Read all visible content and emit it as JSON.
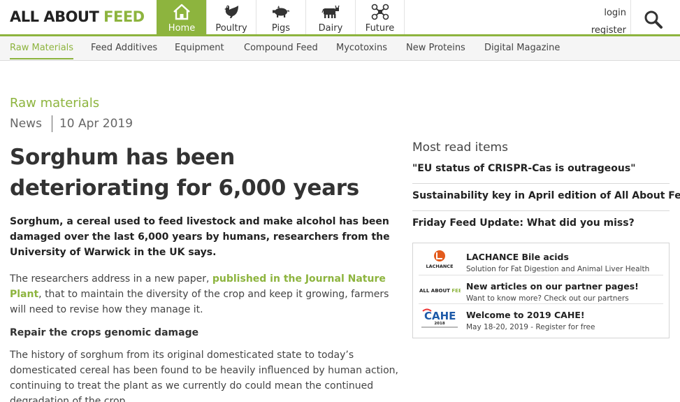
{
  "brand": {
    "name_part1": "ALL ABOUT ",
    "name_part2": "FEED"
  },
  "categories": [
    {
      "label": "Home",
      "icon": "home-icon",
      "active": true
    },
    {
      "label": "Poultry",
      "icon": "chicken-icon"
    },
    {
      "label": "Pigs",
      "icon": "pig-icon"
    },
    {
      "label": "Dairy",
      "icon": "cow-icon"
    },
    {
      "label": "Future",
      "icon": "drone-icon"
    }
  ],
  "auth": {
    "login": "login",
    "register": "register"
  },
  "subnav": [
    {
      "label": "Raw Materials",
      "active": true
    },
    {
      "label": "Feed Additives"
    },
    {
      "label": "Equipment"
    },
    {
      "label": "Compound Feed"
    },
    {
      "label": "Mycotoxins"
    },
    {
      "label": "New Proteins"
    },
    {
      "label": "Digital Magazine"
    }
  ],
  "article": {
    "section": "Raw materials",
    "type": "News",
    "date": "10 Apr 2019",
    "title": "Sorghum has been deteriorating for 6,000 years",
    "lead": "Sorghum, a cereal used to feed livestock and make alcohol has been damaged over the last 6,000 years by humans, researchers from the University of Warwick in the UK says.",
    "p1_before": "The researchers address in a new paper, ",
    "p1_link": "published in the Journal Nature Plant",
    "p1_after": ", that to maintain the diversity of the crop and keep it growing, farmers will need to revise how they manage it.",
    "subheading": "Repair the crops genomic damage",
    "p2": "The history of sorghum from its original domesticated state to today’s domesticated cereal has been found to be heavily influenced by human action, continuing to treat the plant as we currently do could mean the continued degradation of the crop."
  },
  "most_read": {
    "title": "Most read items",
    "items": [
      "\"EU status of CRISPR-Cas is outrageous\"",
      "Sustainability key in April edition of All About Feed",
      "Friday Feed Update: What did you miss?"
    ]
  },
  "partners": [
    {
      "title": "LACHANCE Bile acids",
      "subtitle": "Solution for Fat Digestion and Animal Liver Health",
      "logo_text": "LACHANCE"
    },
    {
      "title": "New articles on our partner pages!",
      "subtitle": "Want to know more? Check out our partners",
      "logo_text_1": "ALL ABOUT ",
      "logo_text_2": "FEED"
    },
    {
      "title": "Welcome to 2019 CAHE!",
      "subtitle": "May 18-20, 2019 - Register for free",
      "logo_text": "CAHE",
      "logo_year": "2018"
    }
  ],
  "colors": {
    "accent": "#8db43e",
    "text": "#333333",
    "subnav_bg": "#f5f5f5"
  }
}
